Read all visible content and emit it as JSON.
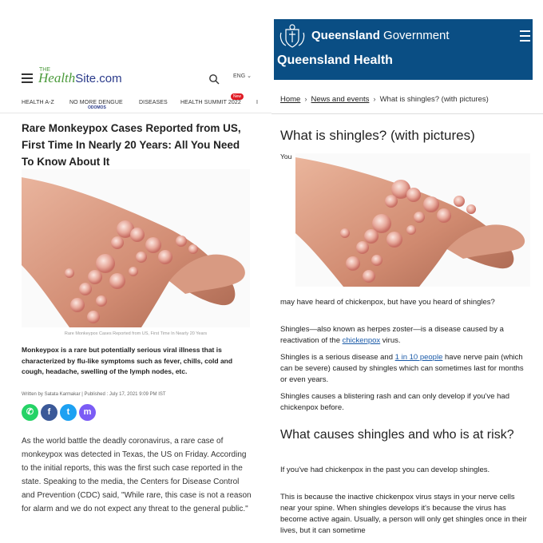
{
  "left": {
    "logo": {
      "the": "THE",
      "health": "Health",
      "site": "Site.com"
    },
    "lang": "ENG",
    "nav": [
      {
        "label": "HEALTH A-Z"
      },
      {
        "label": "NO MORE DENGUE",
        "sub": "ODOMOS"
      },
      {
        "label": "DISEASES"
      },
      {
        "label": "HEALTH SUMMIT 2022",
        "badge": "New"
      },
      {
        "label": "I"
      }
    ],
    "title": "Rare Monkeypox Cases Reported from US, First Time In Nearly 20 Years: All You Need To Know About It",
    "caption": "Rare Monkeypox Cases Reported from US, First Time In Nearly 20 Years",
    "summary": "Monkeypox is a rare but potentially serious viral illness that is characterized by flu-like symptoms such as fever, chills, cold and cough, headache, swelling of the lymph nodes, etc.",
    "byline": "Written by Satata Karmakar | Published : July 17, 2021 9:09 PM IST",
    "share": [
      {
        "name": "whatsapp-icon",
        "color": "#25d366",
        "glyph": "✆"
      },
      {
        "name": "facebook-icon",
        "color": "#3b5998",
        "glyph": "f"
      },
      {
        "name": "twitter-icon",
        "color": "#1da1f2",
        "glyph": "t"
      },
      {
        "name": "messenger-icon",
        "color": "#7b5cf5",
        "glyph": "m"
      }
    ],
    "body": "As the world battle the deadly coronavirus, a rare case of monkeypox was detected in Texas, the US on Friday. According to the initial reports, this was the first such case reported in the state. Speaking to the media, the Centers for Disease Control and Prevention (CDC) said, \"While rare, this case is not a reason for alarm and we do not expect any threat to the general public.\""
  },
  "right": {
    "govt_bold": "Queensland",
    "govt_regular": " Government",
    "health": "Queensland Health",
    "breadcrumb": {
      "home": "Home",
      "news": "News and events",
      "current": "What is shingles? (with pictures)"
    },
    "h1": "What is shingles? (with pictures)",
    "you": "You",
    "p1": "may have heard of chickenpox, but have you heard of shingles?",
    "p2_pre": "Shingles—also known as herpes zoster—is a disease caused by a reactivation of the ",
    "p2_link": "chickenpox",
    "p2_post": " virus.",
    "p3_pre": "Shingles is a serious disease and ",
    "p3_link": "1 in 10 people",
    "p3_post": " have nerve pain (which can be severe) caused by shingles which can sometimes last for months or even years.",
    "p4": "Shingles causes a blistering rash and can only develop if you've had chickenpox before.",
    "h2": "What causes shingles and who is at risk?",
    "p5": "If you've had chickenpox in the past you can develop shingles.",
    "p6": "This is because the inactive chickenpox virus stays in your nerve cells near your spine. When shingles develops it's because the virus has become active again. Usually, a person will only get shingles once in their lives, but it can sometime"
  }
}
